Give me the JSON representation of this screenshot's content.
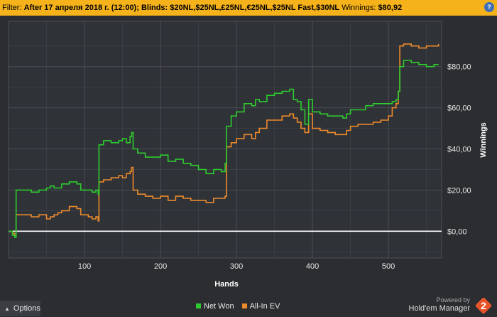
{
  "filter": {
    "prefix": "Filter:",
    "text": "After 17 апреля 2018 г. (12:00); Blinds: $20NL,$25NL,£25NL,€25NL,$25NL Fast,$30NL",
    "winnings_label": "Winnings:",
    "winnings_value": "$80,92",
    "help_icon": "question-icon"
  },
  "chart_data": {
    "type": "line",
    "xlabel": "Hands",
    "ylabel": "Winnings",
    "xlim": [
      0,
      570
    ],
    "ylim": [
      -13,
      102
    ],
    "x_ticks": [
      100,
      200,
      300,
      400,
      500
    ],
    "x_tick_labels": [
      "100",
      "200",
      "300",
      "400",
      "500"
    ],
    "y_ticks": [
      0,
      20,
      40,
      60,
      80
    ],
    "y_tick_labels": [
      "$0,00",
      "$20,00",
      "$40,00",
      "$60,00",
      "$80,00"
    ],
    "grid": true,
    "baseline": 0,
    "legend_position": "bottom-center",
    "series": [
      {
        "name": "Net Won",
        "color": "#2ecc2e",
        "points": [
          [
            0,
            0
          ],
          [
            5,
            -2
          ],
          [
            8,
            -3
          ],
          [
            10,
            20
          ],
          [
            20,
            20
          ],
          [
            30,
            19
          ],
          [
            40,
            20
          ],
          [
            50,
            21
          ],
          [
            55,
            22
          ],
          [
            60,
            21
          ],
          [
            70,
            23
          ],
          [
            80,
            24
          ],
          [
            90,
            23
          ],
          [
            95,
            20
          ],
          [
            105,
            20
          ],
          [
            110,
            19
          ],
          [
            115,
            20
          ],
          [
            118,
            18
          ],
          [
            119,
            42
          ],
          [
            125,
            44
          ],
          [
            135,
            43
          ],
          [
            145,
            44
          ],
          [
            150,
            45
          ],
          [
            155,
            43
          ],
          [
            160,
            46
          ],
          [
            162,
            48
          ],
          [
            164,
            40
          ],
          [
            170,
            38
          ],
          [
            180,
            36
          ],
          [
            190,
            36
          ],
          [
            200,
            37
          ],
          [
            210,
            34
          ],
          [
            220,
            35
          ],
          [
            230,
            33
          ],
          [
            240,
            32
          ],
          [
            250,
            30
          ],
          [
            260,
            28
          ],
          [
            270,
            30
          ],
          [
            280,
            29
          ],
          [
            285,
            33
          ],
          [
            287,
            51
          ],
          [
            293,
            56
          ],
          [
            300,
            58
          ],
          [
            310,
            62
          ],
          [
            320,
            61
          ],
          [
            325,
            64
          ],
          [
            330,
            63
          ],
          [
            340,
            66
          ],
          [
            350,
            67
          ],
          [
            360,
            68
          ],
          [
            370,
            69
          ],
          [
            375,
            64
          ],
          [
            380,
            63
          ],
          [
            385,
            59
          ],
          [
            390,
            52
          ],
          [
            395,
            64
          ],
          [
            400,
            58
          ],
          [
            410,
            57
          ],
          [
            420,
            56
          ],
          [
            430,
            56
          ],
          [
            440,
            55
          ],
          [
            445,
            57
          ],
          [
            450,
            59
          ],
          [
            460,
            59
          ],
          [
            470,
            61
          ],
          [
            480,
            62
          ],
          [
            490,
            62
          ],
          [
            500,
            62
          ],
          [
            505,
            63
          ],
          [
            510,
            64
          ],
          [
            513,
            68
          ],
          [
            515,
            80
          ],
          [
            520,
            83
          ],
          [
            530,
            82
          ],
          [
            540,
            81
          ],
          [
            550,
            80
          ],
          [
            560,
            81
          ],
          [
            566,
            81
          ]
        ]
      },
      {
        "name": "All-In EV",
        "color": "#ec8a2c",
        "points": [
          [
            0,
            0
          ],
          [
            5,
            -1
          ],
          [
            8,
            -2
          ],
          [
            10,
            8
          ],
          [
            20,
            8
          ],
          [
            30,
            7
          ],
          [
            40,
            8
          ],
          [
            50,
            6
          ],
          [
            55,
            7
          ],
          [
            60,
            8
          ],
          [
            65,
            9
          ],
          [
            70,
            10
          ],
          [
            80,
            12
          ],
          [
            90,
            11
          ],
          [
            95,
            8
          ],
          [
            105,
            7
          ],
          [
            110,
            6
          ],
          [
            115,
            7
          ],
          [
            118,
            5
          ],
          [
            119,
            24
          ],
          [
            125,
            25
          ],
          [
            135,
            26
          ],
          [
            145,
            27
          ],
          [
            150,
            26
          ],
          [
            155,
            28
          ],
          [
            160,
            29
          ],
          [
            162,
            31
          ],
          [
            164,
            20
          ],
          [
            170,
            18
          ],
          [
            180,
            17
          ],
          [
            190,
            16
          ],
          [
            200,
            17
          ],
          [
            210,
            15
          ],
          [
            220,
            17
          ],
          [
            230,
            16
          ],
          [
            240,
            15
          ],
          [
            250,
            15
          ],
          [
            260,
            14
          ],
          [
            270,
            16
          ],
          [
            280,
            16
          ],
          [
            285,
            17
          ],
          [
            287,
            41
          ],
          [
            293,
            43
          ],
          [
            300,
            45
          ],
          [
            310,
            47
          ],
          [
            320,
            45
          ],
          [
            325,
            48
          ],
          [
            330,
            50
          ],
          [
            340,
            54
          ],
          [
            350,
            54
          ],
          [
            360,
            56
          ],
          [
            370,
            57
          ],
          [
            375,
            55
          ],
          [
            380,
            53
          ],
          [
            385,
            50
          ],
          [
            390,
            48
          ],
          [
            395,
            57
          ],
          [
            400,
            50
          ],
          [
            410,
            49
          ],
          [
            420,
            48
          ],
          [
            430,
            47
          ],
          [
            440,
            47
          ],
          [
            445,
            49
          ],
          [
            450,
            51
          ],
          [
            460,
            52
          ],
          [
            470,
            52
          ],
          [
            480,
            53
          ],
          [
            490,
            54
          ],
          [
            500,
            56
          ],
          [
            505,
            60
          ],
          [
            510,
            62
          ],
          [
            513,
            68
          ],
          [
            515,
            90
          ],
          [
            520,
            91
          ],
          [
            530,
            90
          ],
          [
            540,
            89
          ],
          [
            550,
            90
          ],
          [
            560,
            90
          ],
          [
            566,
            91
          ]
        ]
      }
    ]
  },
  "bottom": {
    "options_label": "Options",
    "options_icon": "chevron-up-icon",
    "legend": [
      {
        "label": "Net Won",
        "color": "#2ecc2e"
      },
      {
        "label": "All-In EV",
        "color": "#ec8a2c"
      }
    ],
    "powered_by": "Powered by",
    "brand_name": "Hold'em Manager",
    "brand_logo_number": "2"
  }
}
